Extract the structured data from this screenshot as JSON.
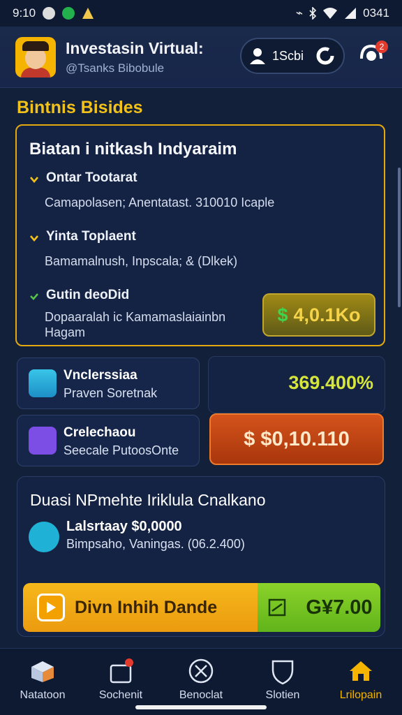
{
  "status": {
    "time": "9:10",
    "clock": "0341"
  },
  "header": {
    "title": "Investasin Virtual:",
    "subtitle": "@Tsanks Bibobule",
    "pill_label": "1Scbi",
    "notification_count": "2"
  },
  "section": {
    "title": "Bintnis Bisides"
  },
  "card1": {
    "title": "Biatan i nitkash Indyaraim",
    "items": [
      {
        "label": "Ontar Tootarat",
        "desc": "Camapolasen; Anentatast. 310010 Icaple"
      },
      {
        "label": "Yinta Toplaent",
        "desc": "Bamamalnush, Inpscala; & (Dlkek)"
      },
      {
        "label": "Gutin deoDid",
        "desc": "Dopaaralah ic Kamamaslaiainbn",
        "desc2": "Hagam"
      }
    ],
    "price": "4,0.1Ko",
    "price_symbol": "$"
  },
  "mini1": {
    "title": "Vnclerssiaa",
    "sub": "Praven Soretnak"
  },
  "mini2": {
    "title": "Crelechaou",
    "sub": "Seecale PutoosOnte"
  },
  "percent": "369.400%",
  "orange_button": "$ $0,10.110",
  "card3": {
    "title": "Duasi NPmehte Iriklula Cnalkano",
    "line1": "Lalsrtaay $0,0000",
    "line2": "Bimpsaho, Vaningas. (06.2.400)",
    "cta_label": "Divn Inhih Dande",
    "green_value": "G¥7.00"
  },
  "nav": [
    {
      "label": "Natatoon"
    },
    {
      "label": "Sochenit"
    },
    {
      "label": "Benoclat"
    },
    {
      "label": "Slotien"
    },
    {
      "label": "Lrilopain"
    }
  ],
  "colors": {
    "accent": "#f2c21b",
    "background": "#13203a",
    "orange": "#d4531b",
    "green": "#8bd22a"
  }
}
